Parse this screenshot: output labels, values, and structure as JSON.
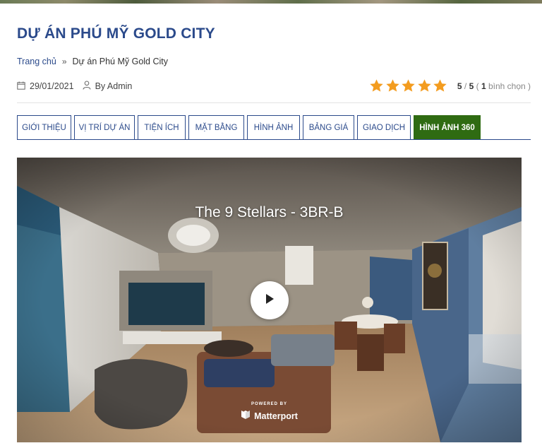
{
  "page": {
    "title": "DỰ ÁN PHÚ MỸ GOLD CITY"
  },
  "breadcrumb": {
    "home": "Trang chủ",
    "separator": "»",
    "current": "Dự án Phú Mỹ Gold City"
  },
  "meta": {
    "date": "29/01/2021",
    "author": "By Admin",
    "date_icon": "calendar-icon",
    "author_icon": "user-icon"
  },
  "rating": {
    "stars_filled": 5,
    "stars_total": 5,
    "score": "5",
    "slash": " / ",
    "max": "5",
    "open_paren": " ( ",
    "votes": "1",
    "votes_label": " bình chọn )",
    "star_color": "#f39c1f"
  },
  "tabs": [
    {
      "label": "GIỚI THIỆU",
      "active": false
    },
    {
      "label": "VỊ TRÍ DỰ ÁN",
      "active": false
    },
    {
      "label": "TIỆN ÍCH",
      "active": false
    },
    {
      "label": "MẶT BẰNG",
      "active": false
    },
    {
      "label": "HÌNH ẢNH",
      "active": false
    },
    {
      "label": "BẢNG GIÁ",
      "active": false
    },
    {
      "label": "GIAO DỊCH",
      "active": false
    },
    {
      "label": "HÌNH ẢNH 360",
      "active": true
    }
  ],
  "viewer": {
    "title": "The 9 Stellars - 3BR-B",
    "play_icon": "play-icon",
    "powered_by": "POWERED BY",
    "brand": "Matterport",
    "brand_icon": "matterport-logo-icon"
  },
  "colors": {
    "title": "#2b4a8b",
    "tab_border": "#2b4a8b",
    "tab_active_bg": "#2f6b12",
    "star": "#f39c1f"
  }
}
